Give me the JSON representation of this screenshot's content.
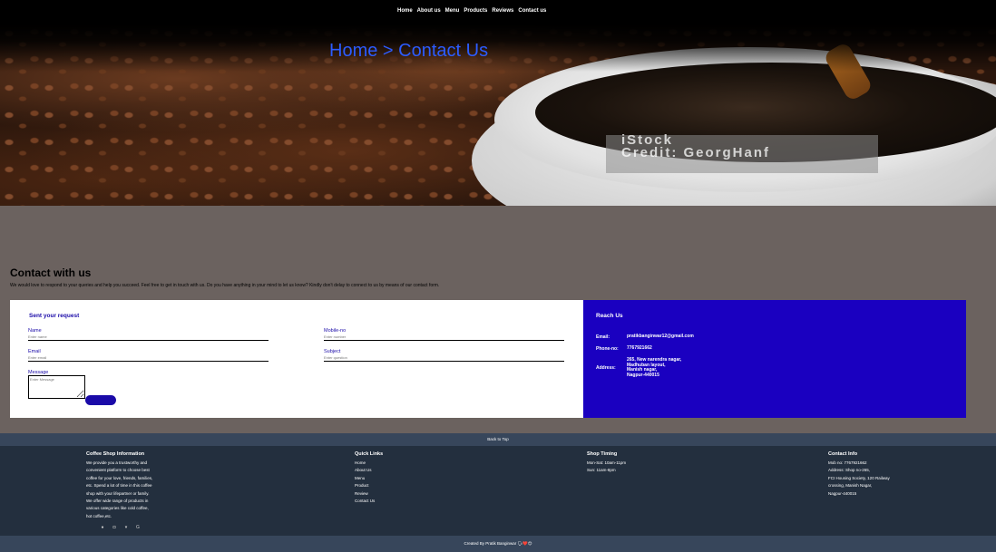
{
  "nav": {
    "items": [
      {
        "label": "Home"
      },
      {
        "label": "About us"
      },
      {
        "label": "Menu"
      },
      {
        "label": "Products"
      },
      {
        "label": "Reviews"
      },
      {
        "label": "Contact us"
      }
    ]
  },
  "hero": {
    "breadcrumb": "Home > Contact Us",
    "watermark": "iStock",
    "watermark_credit": "Credit: GeorgHanf"
  },
  "contact": {
    "title": "Contact with us",
    "description": "We would love to respond to your queries and help you succeed. Feel free to get in touch with us. Do you have anything in your mind to let us know? Kindly don't delay to connect to us by means of our contact form."
  },
  "form": {
    "heading": "Sent your request",
    "name_label": "Name",
    "name_placeholder": "Enter name",
    "mobile_label": "Mobile-no",
    "mobile_placeholder": "Enter number",
    "email_label": "Email",
    "email_placeholder": "Enter email",
    "subject_label": "Subject",
    "subject_placeholder": "Enter question",
    "message_label": "Message",
    "message_placeholder": "Enter Message",
    "send_label": ""
  },
  "reach": {
    "heading": "Reach Us",
    "email_label": "Email:",
    "email_value": "pratikbanginwar12@gmail.com",
    "phone_label": "Phone-no:",
    "phone_value": "7767921662",
    "address_label": "Address:",
    "address_lines": [
      "265, New narendra nagar,",
      "Madhuban layout,",
      "Manish nagar,",
      "Nagpur-440015"
    ]
  },
  "footer": {
    "back_to_top": "Back to Top",
    "info_heading": "Coffee Shop Information",
    "info_lines": [
      "We provide you a trustworthy and",
      "convenient platform to choose best",
      "coffee for your love, friends, families,",
      "etc. Spend a lot of time in this coffee",
      "shop with your lifepartner or family.",
      "We offer wide range of products in",
      "various categories like cold coffee,",
      "hot coffee,etc."
    ],
    "links_heading": "Quick Links",
    "links": [
      "Home",
      "About Us",
      "Menu",
      "Product",
      "Review",
      "Contact Us"
    ],
    "timing_heading": "Shop Timing",
    "timing_lines": [
      "Mon-Sat: 10am-11pm",
      "Sun: 11am-8pm"
    ],
    "contact_heading": "Contact Info",
    "contact_lines": [
      "Mob no: 7767921662",
      "Address: Shop no-265,",
      "FCI Housing Society, 120 Railway",
      "crossing, Manish Nagar,",
      "Nagpur-440015"
    ],
    "social_icons": [
      "facebook-icon",
      "instagram-icon",
      "twitter-icon",
      "google-icon"
    ],
    "credit": "Created By Pratik Banginwar 🗣❤️😊"
  },
  "colors": {
    "accent": "#1a00c0",
    "page_bg": "#6b625f",
    "footer_bg": "#232f3e"
  }
}
